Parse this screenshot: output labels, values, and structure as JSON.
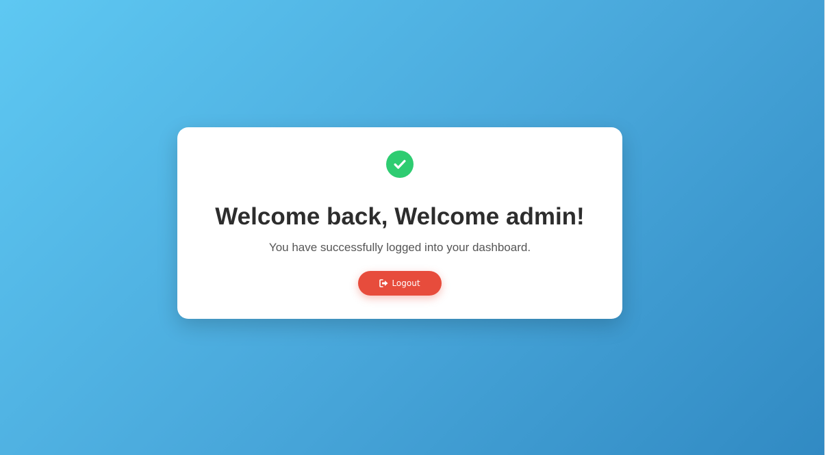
{
  "colors": {
    "success": "#2ecc71",
    "danger": "#e74c3c",
    "heading": "#2d2d2d",
    "text": "#555555"
  },
  "icons": {
    "status": "check-circle-icon",
    "logout": "sign-out-icon"
  },
  "welcome": {
    "title": "Welcome back, Welcome admin!",
    "message": "You have successfully logged into your dashboard."
  },
  "actions": {
    "logout_label": "Logout"
  }
}
